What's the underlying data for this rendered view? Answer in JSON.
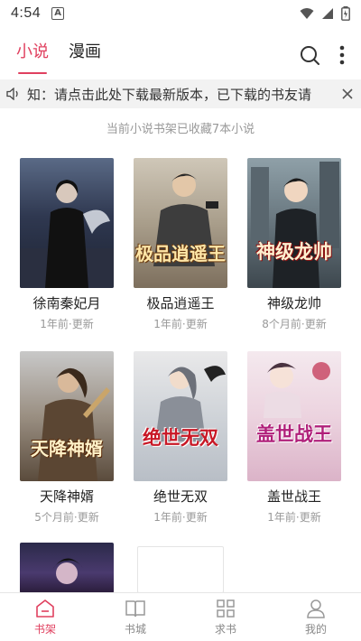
{
  "status": {
    "time": "4:54"
  },
  "header": {
    "tabs": [
      {
        "label": "小说",
        "active": true
      },
      {
        "label": "漫画",
        "active": false
      }
    ]
  },
  "notice": {
    "text": "知：请点击此处下载最新版本，已下载的书友请"
  },
  "shelf": {
    "summary": "当前小说书架已收藏7本小说"
  },
  "books": [
    {
      "title": "徐南秦妃月",
      "updated": "1年前·更新",
      "cover_text": ""
    },
    {
      "title": "极品逍遥王",
      "updated": "1年前·更新",
      "cover_text": "极品逍遥王"
    },
    {
      "title": "神级龙帅",
      "updated": "8个月前·更新",
      "cover_text": "神级龙帅"
    },
    {
      "title": "天降神婿",
      "updated": "5个月前·更新",
      "cover_text": "天降神婿"
    },
    {
      "title": "绝世无双",
      "updated": "1年前·更新",
      "cover_text": "绝世无双"
    },
    {
      "title": "盖世战王",
      "updated": "1年前·更新",
      "cover_text": "盖世战王"
    }
  ],
  "bottom_nav": [
    {
      "label": "书架",
      "icon": "bookshelf-icon",
      "active": true
    },
    {
      "label": "书城",
      "icon": "book-open-icon",
      "active": false
    },
    {
      "label": "求书",
      "icon": "grid-icon",
      "active": false
    },
    {
      "label": "我的",
      "icon": "user-icon",
      "active": false
    }
  ],
  "colors": {
    "accent": "#e0405f",
    "muted": "#999999",
    "notice_bg": "#f2f2f2"
  }
}
